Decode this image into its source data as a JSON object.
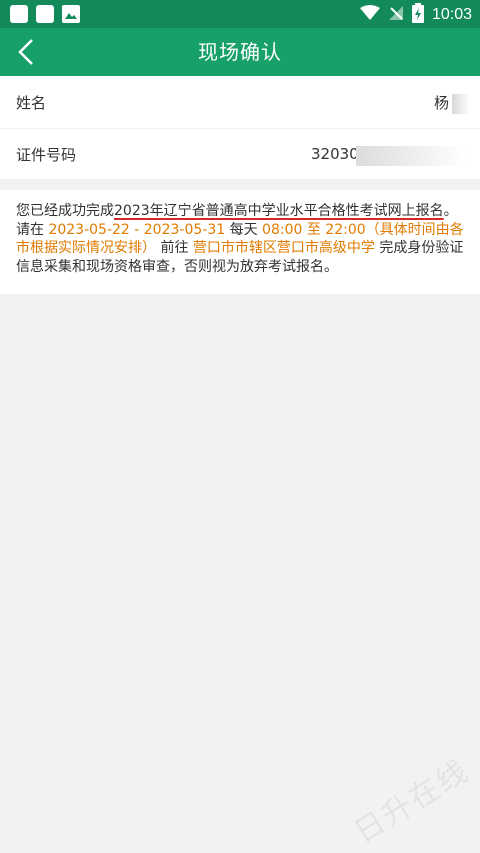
{
  "status_bar": {
    "time": "10:03",
    "icons": [
      "notification-square-icon",
      "notification-square-icon",
      "image-icon",
      "wifi-icon",
      "no-signal-icon",
      "battery-charging-icon"
    ]
  },
  "header": {
    "title": "现场确认",
    "back_icon": "chevron-left-icon"
  },
  "fields": [
    {
      "label": "姓名",
      "value": "杨"
    },
    {
      "label": "证件号码",
      "value": "32030"
    }
  ],
  "notice": {
    "part1": "您已经成功完成",
    "exam_name": "2023年辽宁省普通高中学业水平合格性考试网上报名",
    "part2": "。请在 ",
    "date_range": "2023-05-22 - 2023-05-31",
    "part3": " 每天 ",
    "time_range": "08:00 至 22:00（具体时间由各市根据实际情况安排）",
    "part4": " 前往 ",
    "location": "营口市市辖区营口市高级中学",
    "part5": " 完成身份验证信息采集和现场资格审查，否则视为放弃考试报名。"
  },
  "colors": {
    "status_bar": "#138a5a",
    "app_bar": "#17a067",
    "highlight": "#e07b00",
    "underline_mark": "#d62828"
  }
}
